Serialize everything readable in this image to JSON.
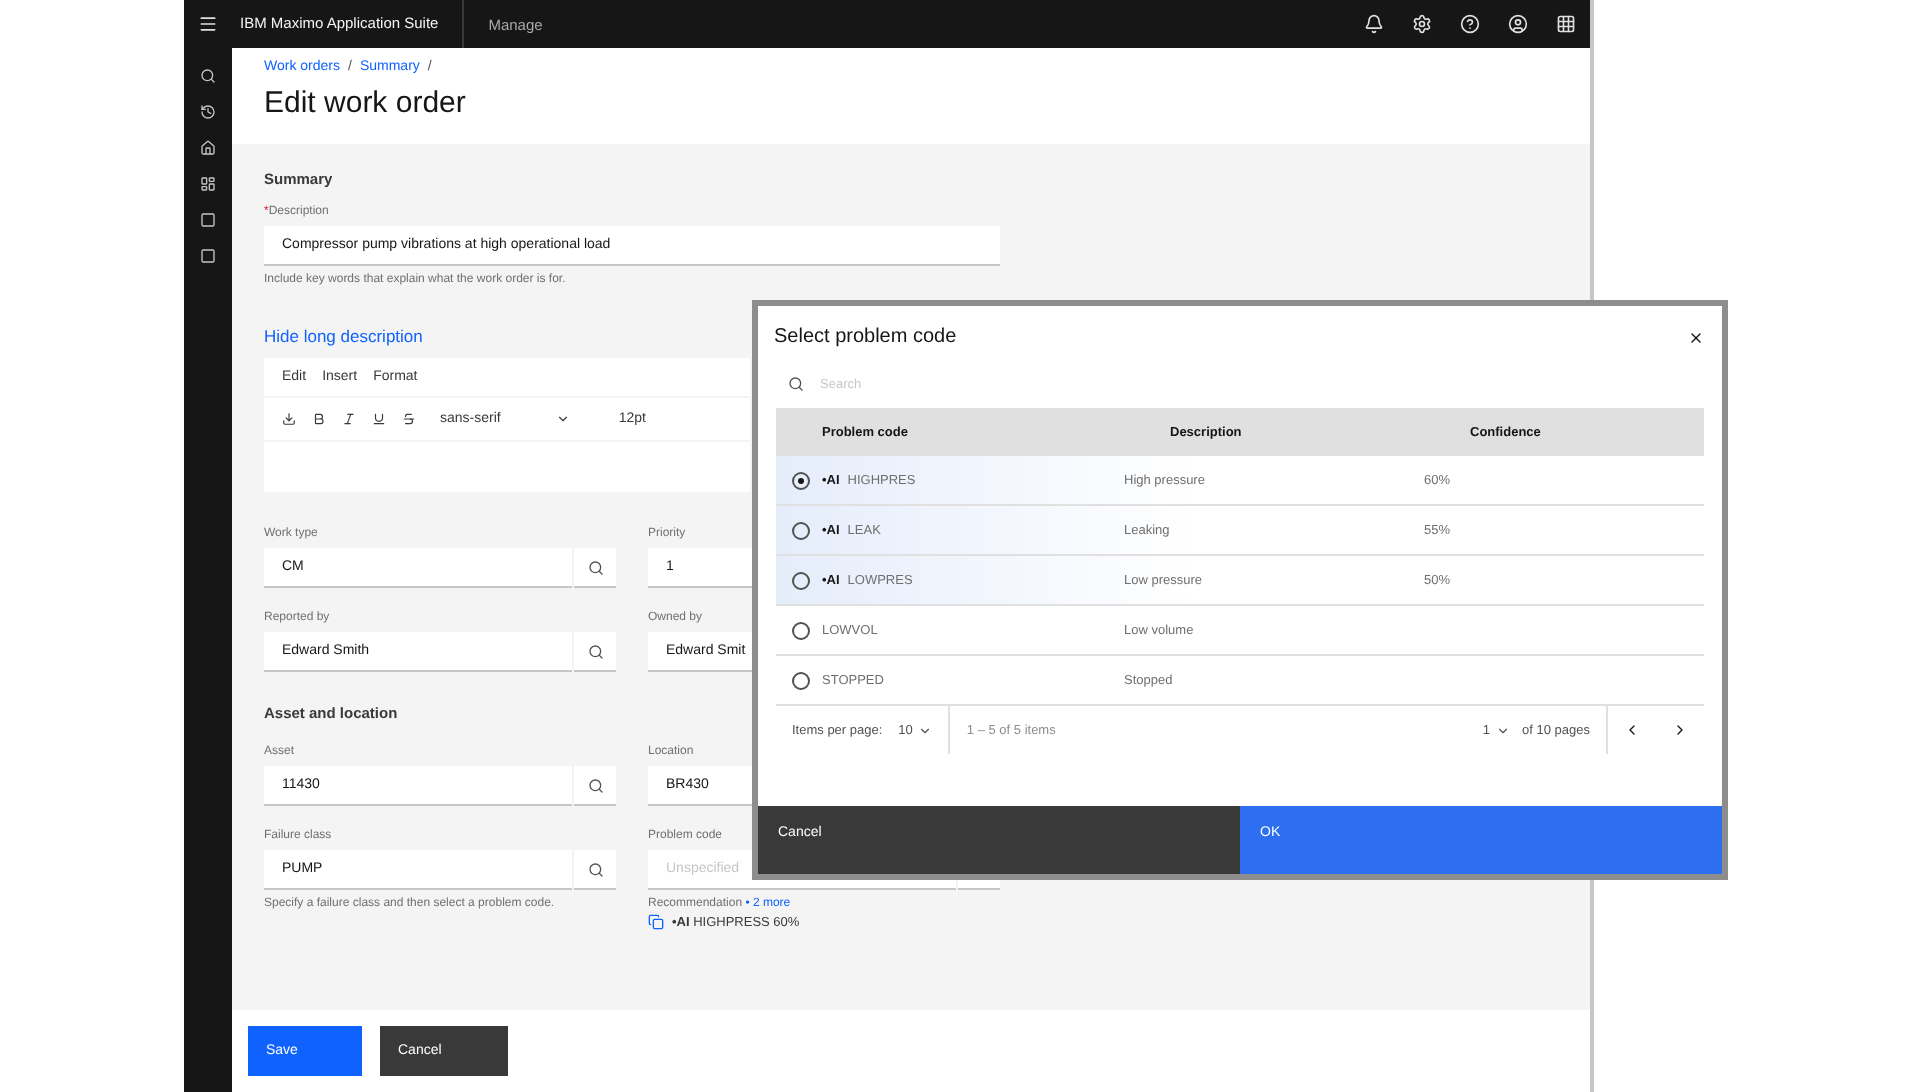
{
  "top_bar": {
    "brand": "IBM Maximo Application Suite",
    "app": "Manage"
  },
  "breadcrumb": {
    "items": [
      "Work orders",
      "Summary"
    ],
    "separator": "/"
  },
  "page_title": "Edit work order",
  "summary": {
    "heading": "Summary",
    "required_mark": "*",
    "label": "Description",
    "value": "Compressor pump vibrations at high operational load",
    "helper": "Include key words that explain what the work order is for.",
    "long_description_toggle": "Hide long description",
    "editor": {
      "menu": [
        "Edit",
        "Insert",
        "Format"
      ],
      "font": "sans-serif",
      "size": "12pt"
    }
  },
  "work_fields": [
    {
      "label": "Work type",
      "value": "CM"
    },
    {
      "label": "Priority",
      "value": "1"
    },
    {
      "label": "Reported by",
      "value": "Edward Smith"
    },
    {
      "label": "Owned by",
      "value": "Edward Smit"
    }
  ],
  "asset_heading": "Asset and location",
  "asset_fields": [
    {
      "label": "Asset",
      "value": "11430"
    },
    {
      "label": "Location",
      "value": "BR430"
    },
    {
      "label": "Failure class",
      "value": "PUMP",
      "helper": "Specify a failure class and then select a problem code."
    },
    {
      "label": "Problem code",
      "placeholder": "Unspecified",
      "recommendation": {
        "label": "Recommendation",
        "link": "• 2 more",
        "value": "**•AI** HIGHPRESS 60%"
      }
    }
  ],
  "footer_buttons": [
    {
      "label": "Save",
      "kind": "primary"
    },
    {
      "label": "Cancel",
      "kind": "secondary"
    }
  ],
  "dialog": {
    "title": "Select problem code",
    "search": {
      "placeholder": "Search"
    },
    "columns": [
      "Problem code",
      "Description",
      "Confidence"
    ],
    "rows": [
      {
        "selected": true,
        "ai_tag": "•AI",
        "code": "HIGHPRES",
        "description": "High pressure",
        "confidence": "60%"
      },
      {
        "selected": false,
        "ai_tag": "•AI",
        "code": "LEAK",
        "description": "Leaking",
        "confidence": "55%"
      },
      {
        "selected": false,
        "ai_tag": "•AI",
        "code": "LOWPRES",
        "description": "Low pressure",
        "confidence": "50%"
      },
      {
        "selected": false,
        "code": "LOWVOL",
        "description": "Low volume"
      },
      {
        "selected": false,
        "code": "STOPPED",
        "description": "Stopped"
      }
    ],
    "pagination": {
      "items_per_page_label": "Items per page:",
      "items_per_page": "10",
      "range": "1 – 5 of 5 items",
      "page": "1",
      "pages": "of 10 pages"
    },
    "buttons": [
      {
        "label": "Cancel",
        "kind": "secondary"
      },
      {
        "label": "OK",
        "kind": "primary"
      }
    ]
  }
}
